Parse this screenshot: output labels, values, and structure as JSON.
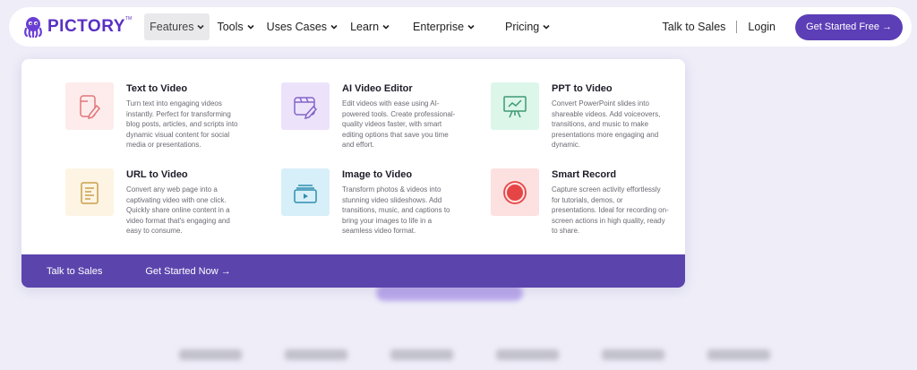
{
  "brand": {
    "name": "PICTORY",
    "tm": "TM",
    "color": "#5a2fc2"
  },
  "nav": {
    "items": [
      {
        "label": "Features",
        "active": true
      },
      {
        "label": "Tools"
      },
      {
        "label": "Uses Cases"
      },
      {
        "label": "Learn"
      },
      {
        "label": "Enterprise"
      },
      {
        "label": "Pricing"
      }
    ],
    "talk_to_sales": "Talk to Sales",
    "login": "Login",
    "cta": "Get Started Free →"
  },
  "features": [
    {
      "title": "Text to Video",
      "icon": "document-edit-icon",
      "bg": "#fdeceb",
      "accent": "#e1767a",
      "desc": "Turn text into engaging videos instantly. Perfect for transforming blog posts, articles, and scripts into dynamic visual content for social media or presentations."
    },
    {
      "title": "AI Video Editor",
      "icon": "video-edit-icon",
      "bg": "#ece3fb",
      "accent": "#8464c9",
      "desc": "Edit videos with ease using AI-powered tools. Create professional-quality videos faster, with smart editing options that save you time and effort."
    },
    {
      "title": "PPT to Video",
      "icon": "presentation-board-icon",
      "bg": "#dcf6ea",
      "accent": "#3f9a72",
      "desc": "Convert PowerPoint slides into shareable videos. Add voiceovers, transitions, and music to make presentations more engaging and dynamic."
    },
    {
      "title": "URL to Video",
      "icon": "web-page-icon",
      "bg": "#fdf4e3",
      "accent": "#caa04a",
      "desc": "Convert any web page into a captivating video with one click. Quickly share online content in a video format that's engaging and easy to consume."
    },
    {
      "title": "Image to Video",
      "icon": "image-stack-play-icon",
      "bg": "#d7eff8",
      "accent": "#2f8fb0",
      "desc": "Transform photos & videos into stunning video slideshows. Add transitions, music, and captions to bring your images to life in a seamless video format."
    },
    {
      "title": "Smart Record",
      "icon": "record-icon",
      "bg": "#fde0e0",
      "accent": "#e64545",
      "desc": "Capture screen activity effortlessly for tutorials, demos, or presentations. Ideal for recording on-screen actions in high quality, ready to share."
    }
  ],
  "footer": {
    "talk_to_sales": "Talk to Sales",
    "get_started": "Get Started Now →",
    "bg": "#5b45ad"
  }
}
